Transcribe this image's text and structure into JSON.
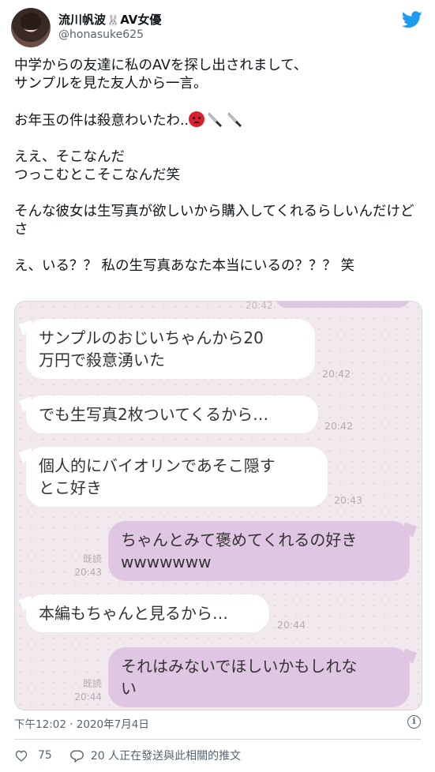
{
  "header": {
    "display_name_part1": "流川帆波",
    "display_name_emoji": "🐰",
    "display_name_part2": "AV女優",
    "handle": "@honasuke625"
  },
  "tweet": {
    "p1": "中学からの友達に私のAVを探し出されまして、\nサンプルを見た友人から一言。",
    "p2_text": "お年玉の件は殺意わいたわ..",
    "p3": "ええ、そこなんだ\nつっこむとこそこなんだ笑",
    "p4": "そんな彼女は生写真が欲しいから購入してくれるらしいんだけどさ",
    "p5": "え、いる？？ 私の生写真あなた本当にいるの？？？ 笑"
  },
  "chat": {
    "peek_time": "20:42",
    "messages": [
      {
        "side": "left",
        "text": "サンプルのおじいちゃんから20\n万円で殺意湧いた",
        "time": "20:42"
      },
      {
        "side": "left",
        "text": "でも生写真2枚ついてくるから…",
        "time": "20:42"
      },
      {
        "side": "left",
        "text": "個人的にバイオリンであそこ隠す\nとこ好き",
        "time": "20:43"
      },
      {
        "side": "right",
        "text": "ちゃんとみて褒めてくれるの好き\nwwwwwww",
        "read": "既読",
        "time": "20:43"
      },
      {
        "side": "left",
        "text": "本編もちゃんと見るから…",
        "time": "20:44"
      },
      {
        "side": "right",
        "text": "それはみないでほしいかもしれな\nい",
        "read": "既読",
        "time": "20:44"
      }
    ]
  },
  "meta": {
    "timestamp": "下午12:02 · 2020年7月4日"
  },
  "footer": {
    "likes": "75",
    "replies_text": "20 人正在發送與此相關的推文"
  },
  "colors": {
    "twitter_blue": "#1d9bf0",
    "bubble_right": "#dfc6e2",
    "bubble_left": "#ffffff",
    "chat_bg": "#f1e9ee",
    "secondary_text": "#536471"
  },
  "icons": [
    "twitter-bird-icon",
    "angry-face-emoji",
    "knife-emoji",
    "info-icon",
    "heart-icon",
    "reply-icon"
  ]
}
